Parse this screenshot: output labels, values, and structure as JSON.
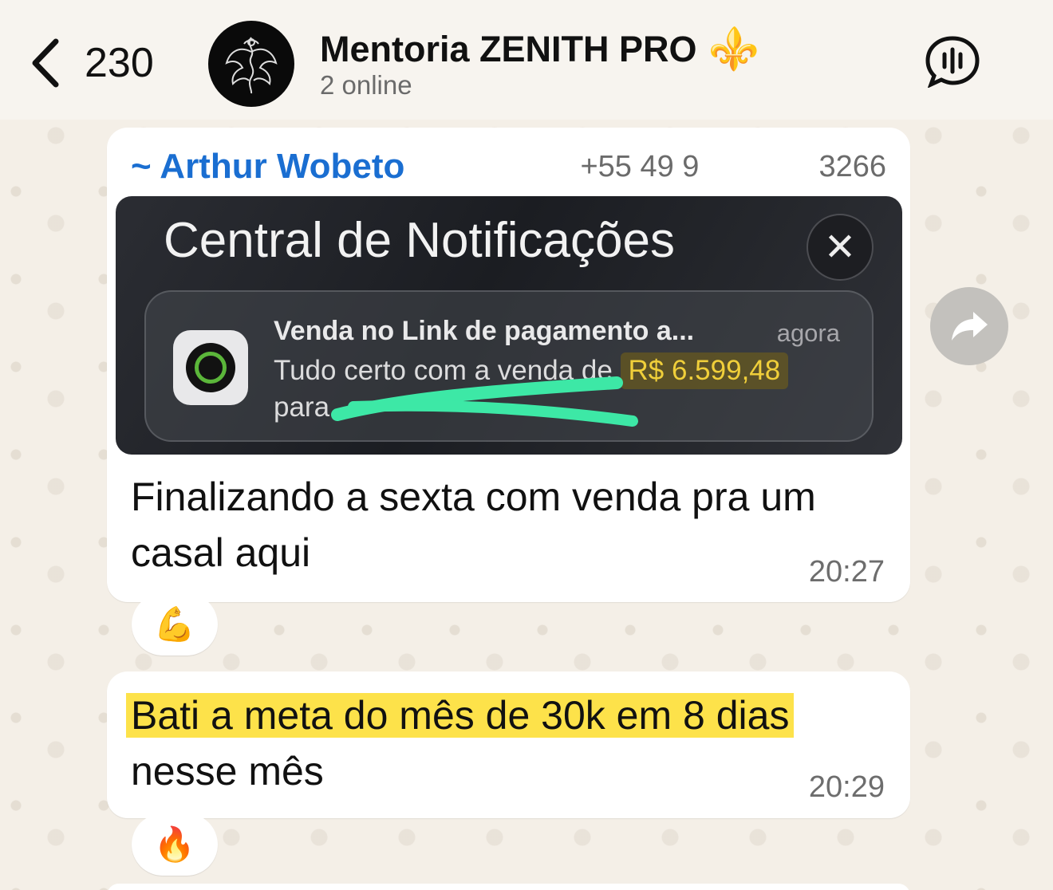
{
  "header": {
    "back_count": "230",
    "title": "Mentoria ZENITH PRO",
    "title_emoji": "⚜️",
    "subtitle": "2 online"
  },
  "messages": [
    {
      "sender": "~ Arthur Wobeto",
      "phone": "+55 49 9",
      "phone_suffix": "3266",
      "screenshot": {
        "title": "Central de Notificações",
        "notification": {
          "title": "Venda no Link de pagamento a...",
          "time": "agora",
          "body_prefix": "Tudo certo com a venda de",
          "amount": "R$ 6.599,48",
          "body_line2": "para"
        }
      },
      "text": "Finalizando a sexta com venda pra um casal aqui",
      "time": "20:27",
      "reaction": "💪"
    },
    {
      "text_highlight": "Bati a meta do mês de 30k em 8 dias",
      "text_rest": "nesse mês",
      "time": "20:29",
      "reaction": "🔥"
    }
  ],
  "colors": {
    "sender": "#1a6ed1",
    "highlight": "#fde24a",
    "amount": "#f0cf3a",
    "background": "#f4efe7"
  }
}
